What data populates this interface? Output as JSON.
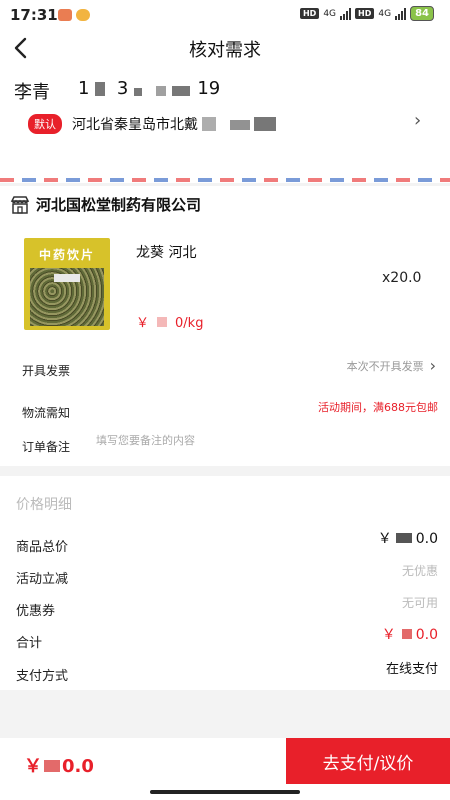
{
  "status_bar": {
    "time": "17:31",
    "network1": "HD",
    "gen1": "4G",
    "network2": "HD",
    "gen2": "4G",
    "battery": "84"
  },
  "header": {
    "title": "核对需求"
  },
  "address": {
    "name": "李青",
    "phone_visible_start": "1",
    "phone_visible_mid": "3",
    "phone_visible_end": "19",
    "default_tag": "默认",
    "address_text": "河北省秦皇岛市北戴"
  },
  "shop": {
    "name": "河北国松堂制药有限公司",
    "product": {
      "image_caption": "中药饮片",
      "title": "龙葵 河北",
      "quantity": "x20.0",
      "price_prefix": "￥",
      "price_suffix": "0/kg"
    },
    "rows": {
      "invoice_label": "开具发票",
      "invoice_value": "本次不开具发票",
      "shipping_label": "物流需知",
      "shipping_value": "活动期间，满688元包邮",
      "remark_label": "订单备注",
      "remark_placeholder": "填写您要备注的内容"
    }
  },
  "price_detail": {
    "title": "价格明细",
    "goods_total_label": "商品总价",
    "goods_total_prefix": "￥",
    "goods_total_suffix": "0.0",
    "promo_label": "活动立减",
    "promo_value": "无优惠",
    "coupon_label": "优惠券",
    "coupon_value": "无可用",
    "sum_label": "合计",
    "sum_prefix": "￥",
    "sum_suffix": "0.0",
    "payment_label": "支付方式",
    "payment_value": "在线支付"
  },
  "bottom_bar": {
    "total_prefix": "￥",
    "total_suffix": "0.0",
    "pay_button": "去支付/议价"
  },
  "colors": {
    "accent": "#e8202a"
  }
}
